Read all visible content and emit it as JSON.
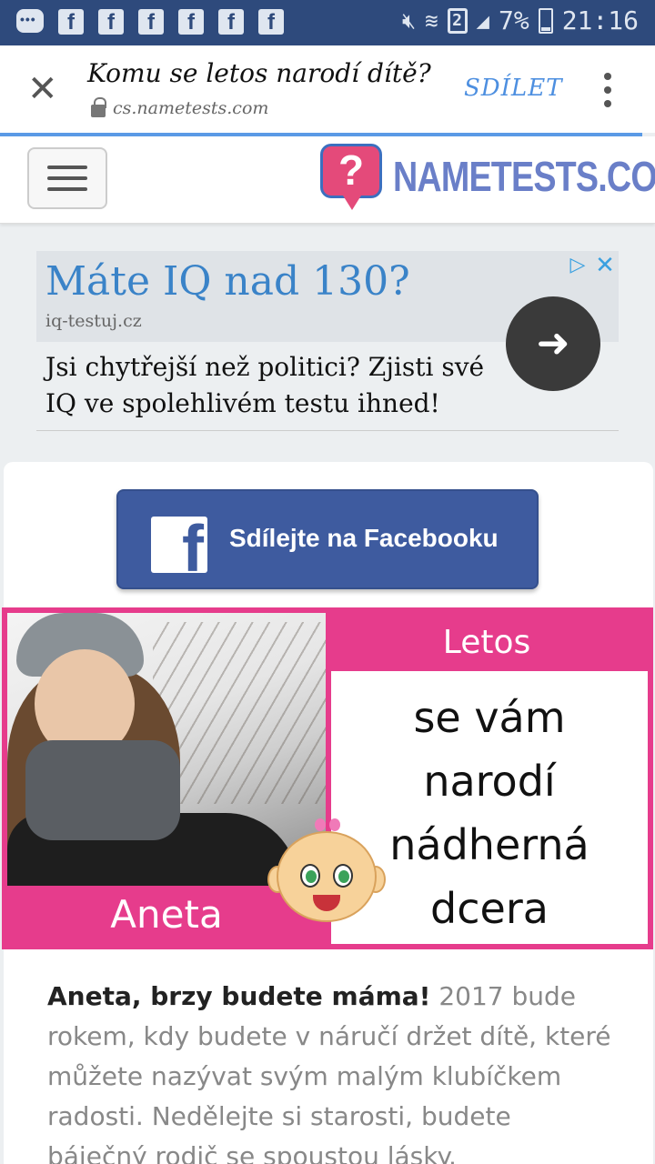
{
  "status_bar": {
    "battery": "7%",
    "time": "21:16",
    "sim": "2",
    "notification_icons": [
      "message-icon",
      "facebook-icon",
      "facebook-icon",
      "facebook-icon",
      "facebook-icon",
      "facebook-icon",
      "facebook-icon"
    ]
  },
  "browser": {
    "title": "Komu se letos narodí dítě?",
    "url": "cs.nametests.com",
    "share_label": "SDÍLET"
  },
  "site": {
    "logo_text": "NAMETESTS.COM",
    "logo_symbol": "?"
  },
  "ad": {
    "headline": "Máte IQ nad 130?",
    "domain": "iq-testuj.cz",
    "body": "Jsi chytřejší než politici? Zjisti své IQ ve spolehlivém testu ihned!"
  },
  "share": {
    "facebook_label": "Sdílejte na Facebooku",
    "facebook_glyph": "f"
  },
  "result": {
    "name": "Aneta",
    "header": "Letos",
    "message_lines": [
      "se vám",
      "narodí",
      "nádherná",
      "dcera"
    ]
  },
  "description": {
    "lead": "Aneta, brzy budete máma!",
    "body": " 2017 bude rokem, kdy budete v náručí držet dítě, které můžete nazývat svým malým klubíčkem radosti. Nedělejte si starosti, budete báječný rodič se spoustou lásky."
  },
  "colors": {
    "status_bar": "#2e4a7c",
    "accent_pink": "#e63c8c",
    "facebook_blue": "#3e5b9f",
    "link_blue": "#4d8fe0"
  }
}
